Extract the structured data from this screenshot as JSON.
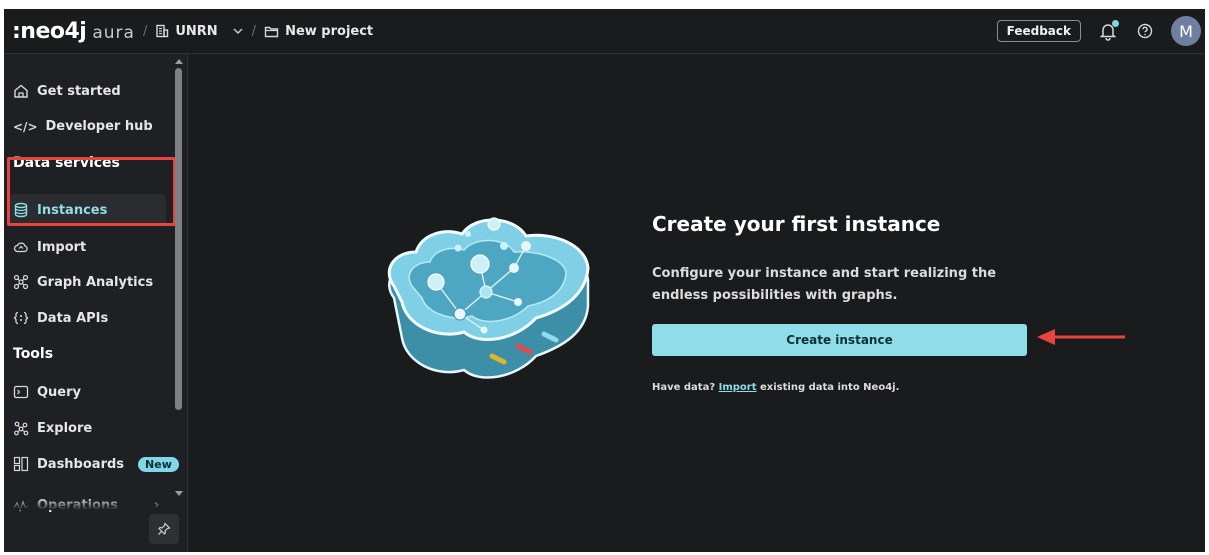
{
  "topbar": {
    "brand_neo": ":neo4j",
    "brand_aura": "aura",
    "org": "UNRN",
    "project": "New project",
    "feedback_label": "Feedback",
    "avatar_initial": "M"
  },
  "sidebar": {
    "items": [
      {
        "label": "Get started",
        "icon": "home-icon"
      },
      {
        "label": "Developer hub",
        "icon": "code-icon"
      },
      {
        "label": "Instances",
        "icon": "database-icon"
      },
      {
        "label": "Import",
        "icon": "cloud-upload-icon"
      },
      {
        "label": "Graph Analytics",
        "icon": "graph-icon"
      },
      {
        "label": "Data APIs",
        "icon": "api-icon"
      },
      {
        "label": "Query",
        "icon": "terminal-icon"
      },
      {
        "label": "Explore",
        "icon": "explore-icon"
      },
      {
        "label": "Dashboards",
        "icon": "dashboard-icon",
        "badge": "New"
      },
      {
        "label": "Operations",
        "icon": "operations-icon"
      }
    ],
    "sections": {
      "data_services": "Data services",
      "tools": "Tools"
    },
    "active_item": "Instances"
  },
  "main": {
    "title": "Create your first instance",
    "description": "Configure your instance and start realizing the endless possibilities with graphs.",
    "create_button": "Create instance",
    "import_prefix": "Have data?",
    "import_link": "Import",
    "import_suffix": "existing data into Neo4j."
  },
  "colors": {
    "accent": "#8fdde8",
    "highlight": "#e8433f",
    "background": "#1a1b1d"
  }
}
